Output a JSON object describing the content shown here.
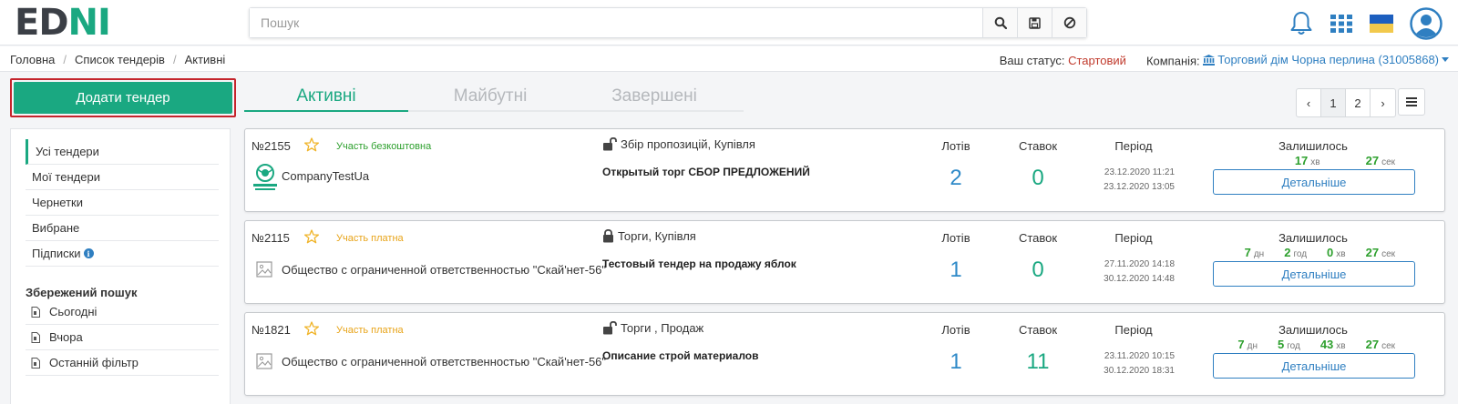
{
  "header": {
    "logo_part1": "ED",
    "logo_part2": "N",
    "logo_part3": "I",
    "search_placeholder": "Пошук",
    "icons": [
      "search-icon",
      "save-icon",
      "clear-icon",
      "bell-icon",
      "apps-grid-icon",
      "flag-ua-icon",
      "user-avatar-icon"
    ],
    "colors": {
      "brand": "#1aa881",
      "dark": "#3b3f46",
      "flag_blue": "#1d5fbf",
      "flag_yellow": "#f2c94c"
    }
  },
  "breadcrumb": [
    "Головна",
    "Список тендерів",
    "Активні"
  ],
  "status": {
    "label": "Ваш статус:",
    "value": "Стартовий",
    "company_label": "Компанія:",
    "company_value": "Торговий дім Чорна перлина (31005868)"
  },
  "actions": {
    "add_tender": "Додати тендер"
  },
  "tabs": [
    {
      "label": "Активні",
      "active": true
    },
    {
      "label": "Майбутні",
      "active": false
    },
    {
      "label": "Завершені",
      "active": false
    }
  ],
  "pagination": {
    "prev": "‹",
    "pages": [
      "1",
      "2"
    ],
    "current": "1",
    "next": "›"
  },
  "sidebar": {
    "items": [
      {
        "label": "Усі тендери",
        "active": true
      },
      {
        "label": "Мої тендери"
      },
      {
        "label": "Чернетки"
      },
      {
        "label": "Вибране"
      },
      {
        "label": "Підписки",
        "info": "i"
      }
    ],
    "saved_title": "Збережений пошук",
    "saved_items": [
      "Сьогодні",
      "Вчора",
      "Останній фільтр"
    ]
  },
  "labels": {
    "lots": "Лотів",
    "bids": "Ставок",
    "period": "Період",
    "remaining": "Залишилось",
    "details": "Детальніше"
  },
  "tenders": [
    {
      "number": "№2155",
      "participation": "Участь безкоштовна",
      "participation_type": "free",
      "org": "CompanyTestUa",
      "has_logo": true,
      "tender_type": "Збір пропозицій, Купівля",
      "lock": "open",
      "title": "Открытый торг СБОР ПРЕДЛОЖЕНИЙ",
      "lots": "2",
      "bids": "0",
      "period_start": "23.12.2020 11:21",
      "period_end": "23.12.2020 13:05",
      "remaining": [
        {
          "value": "17",
          "unit": "хв"
        },
        {
          "value": "27",
          "unit": "сек"
        }
      ]
    },
    {
      "number": "№2115",
      "participation": "Участь платна",
      "participation_type": "paid",
      "org": "Общество с ограниченной ответственностью \"Скай'нет-56\"",
      "has_logo": false,
      "tender_type": "Торги, Купівля",
      "lock": "closed",
      "title": "Тестовый тендер на продажу яблок",
      "lots": "1",
      "bids": "0",
      "period_start": "27.11.2020 14:18",
      "period_end": "30.12.2020 14:48",
      "remaining": [
        {
          "value": "7",
          "unit": "дн"
        },
        {
          "value": "2",
          "unit": "год"
        },
        {
          "value": "0",
          "unit": "хв"
        },
        {
          "value": "27",
          "unit": "сек"
        }
      ]
    },
    {
      "number": "№1821",
      "participation": "Участь платна",
      "participation_type": "paid",
      "org": "Общество с ограниченной ответственностью \"Скай'нет-56\"",
      "has_logo": false,
      "tender_type": "Торги , Продаж",
      "lock": "open",
      "title": "Описание строй материалов",
      "lots": "1",
      "bids": "11",
      "period_start": "23.11.2020 10:15",
      "period_end": "30.12.2020 18:31",
      "remaining": [
        {
          "value": "7",
          "unit": "дн"
        },
        {
          "value": "5",
          "unit": "год"
        },
        {
          "value": "43",
          "unit": "хв"
        },
        {
          "value": "27",
          "unit": "сек"
        }
      ]
    }
  ]
}
